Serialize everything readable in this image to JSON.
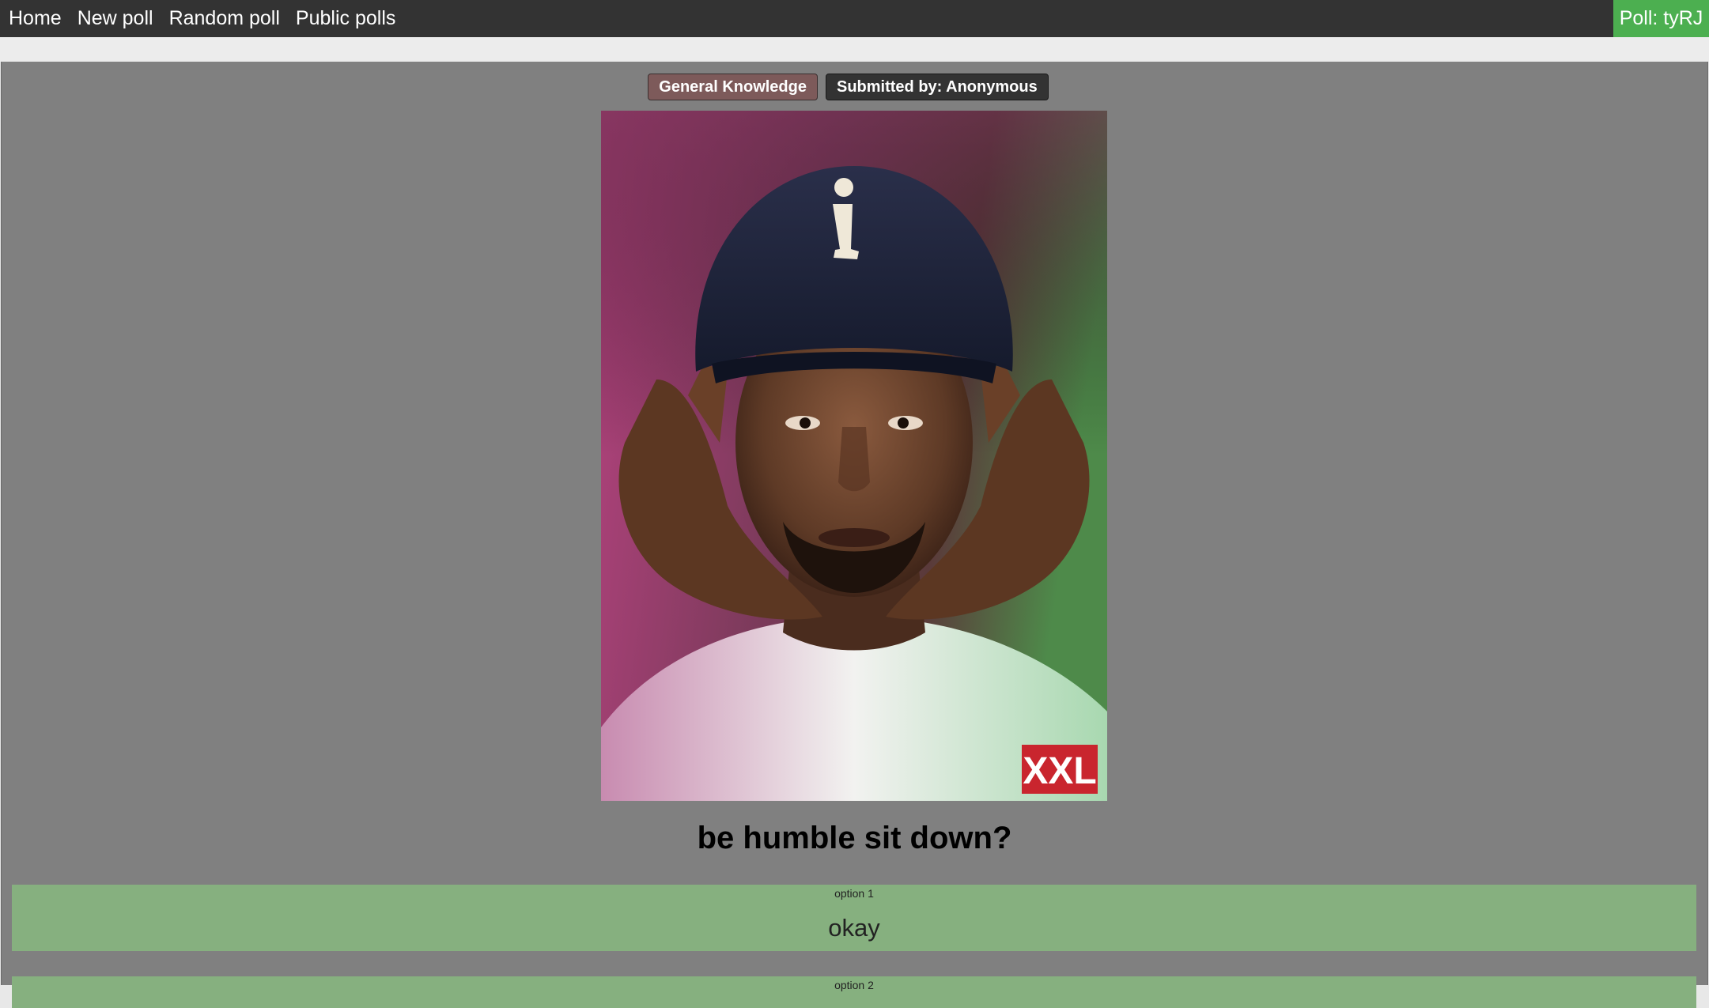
{
  "nav": {
    "home": "Home",
    "new_poll": "New poll",
    "random_poll": "Random poll",
    "public_polls": "Public polls",
    "poll_id": "Poll: tyRJ"
  },
  "poll": {
    "category": "General Knowledge",
    "submitted_by": "Submitted by: Anonymous",
    "image_badge": "XXL",
    "question": "be humble sit down?",
    "options": [
      {
        "label": "option 1",
        "text": "okay"
      },
      {
        "label": "option 2",
        "text": ""
      }
    ]
  },
  "colors": {
    "topbar": "#333333",
    "poll_id_bg": "#4caf50",
    "page_bg": "#808080",
    "option_bg": "#86b07f",
    "category_tag": "#7d5a5a",
    "author_tag": "#333333"
  }
}
